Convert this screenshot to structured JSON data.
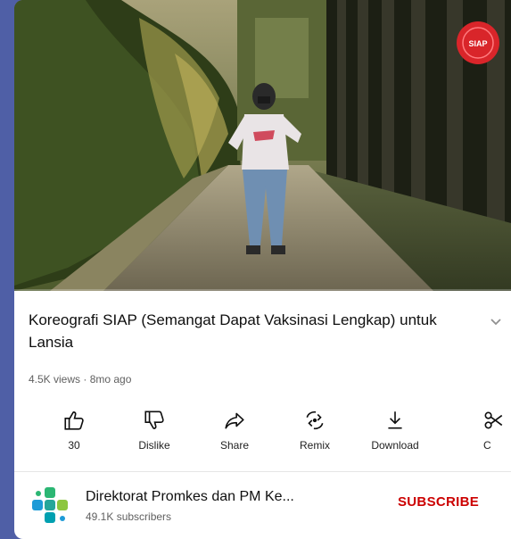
{
  "video": {
    "thumbnail_description_icon": "video-player",
    "watermark_badge_text": "SIAP",
    "progress_fraction": 0.0
  },
  "title": "Koreografi SIAP (Semangat Dapat Vaksinasi Lengkap) untuk Lansia",
  "meta": "4.5K views · 8mo ago",
  "actions": [
    {
      "icon": "thumbs-up-icon",
      "label": "30"
    },
    {
      "icon": "thumbs-down-icon",
      "label": "Dislike"
    },
    {
      "icon": "share-icon",
      "label": "Share"
    },
    {
      "icon": "remix-icon",
      "label": "Remix"
    },
    {
      "icon": "download-icon",
      "label": "Download"
    },
    {
      "icon": "clip-icon",
      "label": "C"
    }
  ],
  "channel": {
    "name": "Direktorat Promkes dan PM Ke...",
    "subscribers": "49.1K subscribers",
    "subscribe_label": "SUBSCRIBE"
  },
  "colors": {
    "brand_red": "#cc0000",
    "background": "#4f5fa6"
  }
}
